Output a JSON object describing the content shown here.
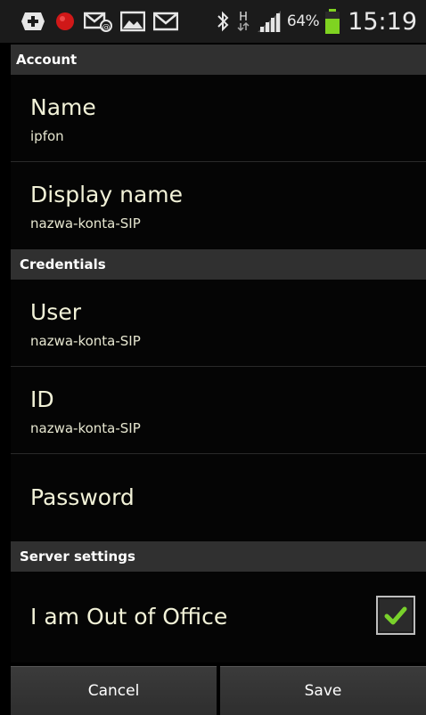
{
  "status_bar": {
    "icons": [
      "plus-box-icon",
      "recording-dot-icon",
      "voicemail-icon",
      "gallery-icon",
      "gmail-icon",
      "bluetooth-icon",
      "hspa-data-icon",
      "signal-icon",
      "battery-icon"
    ],
    "battery_percent": "64%",
    "time": "15:19",
    "battery_color": "#7fd321"
  },
  "sections": {
    "account": {
      "header": "Account",
      "items": [
        {
          "title": "Name",
          "summary": "ipfon"
        },
        {
          "title": "Display name",
          "summary": "nazwa-konta-SIP"
        }
      ]
    },
    "credentials": {
      "header": "Credentials",
      "items": [
        {
          "title": "User",
          "summary": "nazwa-konta-SIP"
        },
        {
          "title": "ID",
          "summary": "nazwa-konta-SIP"
        },
        {
          "title": "Password"
        }
      ]
    },
    "server_settings": {
      "header": "Server settings",
      "items": [
        {
          "title": "I am Out of Office",
          "checked": true
        }
      ]
    }
  },
  "buttons": {
    "cancel": "Cancel",
    "save": "Save"
  },
  "colors": {
    "check_mark": "#79d12b",
    "section_header_bg": "#303030",
    "title_text": "#f2f2d8"
  }
}
